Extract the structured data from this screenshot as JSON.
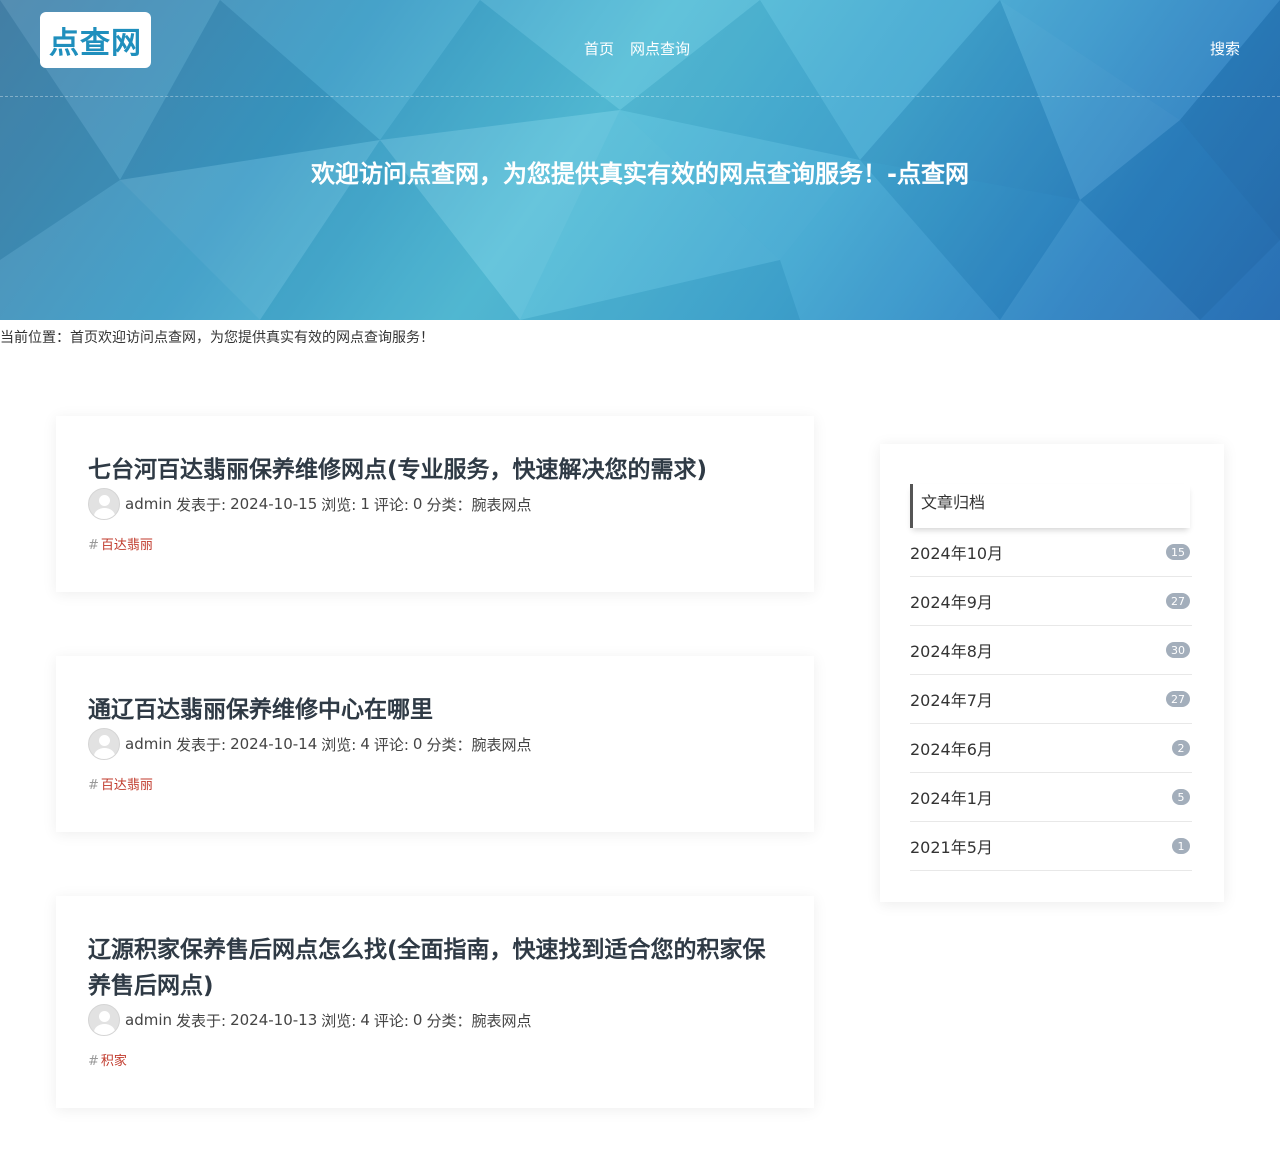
{
  "header": {
    "logo_text": "点查网",
    "nav": [
      "首页",
      "网点查询"
    ],
    "search_label": "搜索",
    "banner_title": "欢迎访问点查网，为您提供真实有效的网点查询服务！-点查网"
  },
  "breadcrumb": "当前位置：首页欢迎访问点查网，为您提供真实有效的网点查询服务！",
  "articles": [
    {
      "title": "七台河百达翡丽保养维修网点(专业服务，快速解决您的需求)",
      "author": "admin",
      "published_label": "发表于:",
      "date": "2024-10-15",
      "views_label": "浏览:",
      "views": "1",
      "comments_label": "评论:",
      "comments": "0",
      "category_label": "分类：",
      "category": "腕表网点",
      "tag_hash": "#",
      "tag": "百达翡丽"
    },
    {
      "title": "通辽百达翡丽保养维修中心在哪里",
      "author": "admin",
      "published_label": "发表于:",
      "date": "2024-10-14",
      "views_label": "浏览:",
      "views": "4",
      "comments_label": "评论:",
      "comments": "0",
      "category_label": "分类：",
      "category": "腕表网点",
      "tag_hash": "#",
      "tag": "百达翡丽"
    },
    {
      "title": "辽源积家保养售后网点怎么找(全面指南，快速找到适合您的积家保养售后网点)",
      "author": "admin",
      "published_label": "发表于:",
      "date": "2024-10-13",
      "views_label": "浏览:",
      "views": "4",
      "comments_label": "评论:",
      "comments": "0",
      "category_label": "分类：",
      "category": "腕表网点",
      "tag_hash": "#",
      "tag": "积家"
    }
  ],
  "sidebar": {
    "heading": "文章归档",
    "archives": [
      {
        "month": "2024年10月",
        "count": "15"
      },
      {
        "month": "2024年9月",
        "count": "27"
      },
      {
        "month": "2024年8月",
        "count": "30"
      },
      {
        "month": "2024年7月",
        "count": "27"
      },
      {
        "month": "2024年6月",
        "count": "2"
      },
      {
        "month": "2024年1月",
        "count": "5"
      },
      {
        "month": "2021年5月",
        "count": "1"
      }
    ]
  }
}
